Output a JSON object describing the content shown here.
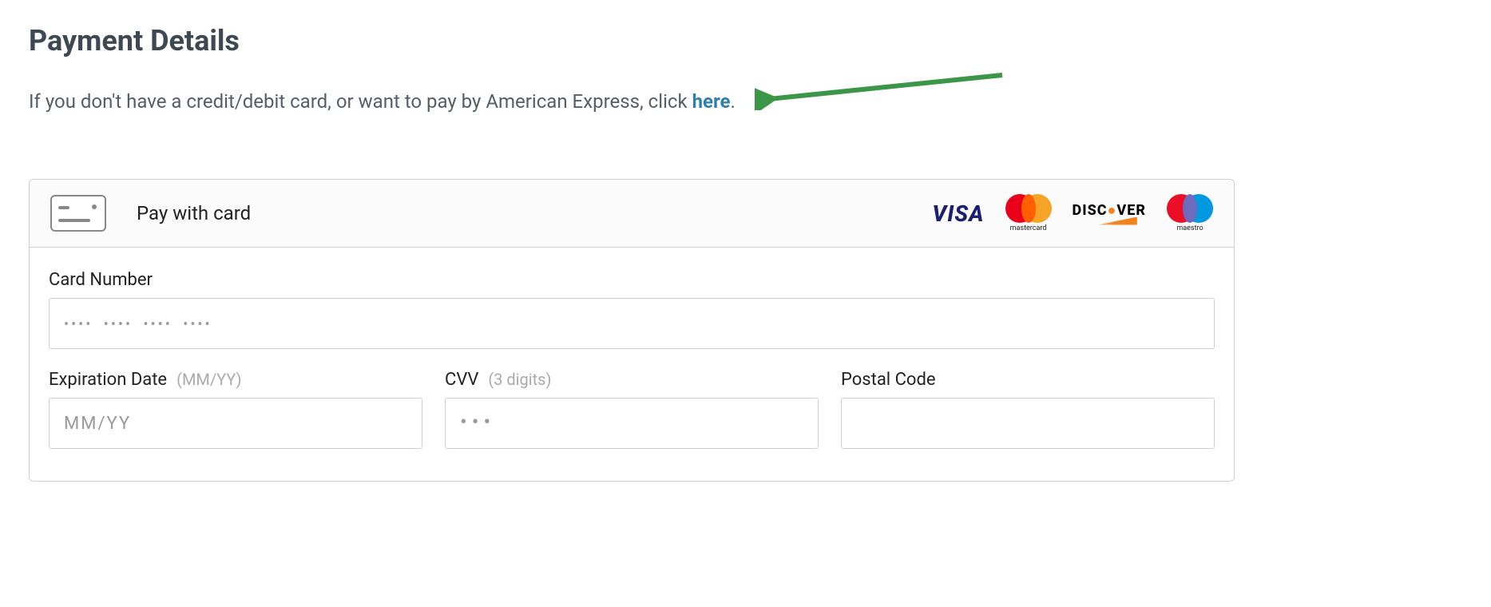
{
  "title": "Payment Details",
  "subtitle_prefix": "If you don't have a credit/debit card, or want to pay by American Express, click ",
  "subtitle_link": "here",
  "subtitle_suffix": ".",
  "header": {
    "pay_with": "Pay with card",
    "brands": {
      "visa": "VISA",
      "mastercard_label": "mastercard",
      "discover": "DISCOVER",
      "maestro_label": "maestro"
    }
  },
  "fields": {
    "card_number": {
      "label": "Card Number",
      "placeholder": "•••• •••• •••• ••••"
    },
    "expiration": {
      "label": "Expiration Date",
      "hint": "(MM/YY)",
      "placeholder": "MM/YY"
    },
    "cvv": {
      "label": "CVV",
      "hint": "(3 digits)",
      "placeholder": "•••"
    },
    "postal": {
      "label": "Postal Code",
      "placeholder": ""
    }
  },
  "colors": {
    "arrow": "#3b9648",
    "link": "#2f7eb2",
    "heading": "#3d4852"
  }
}
